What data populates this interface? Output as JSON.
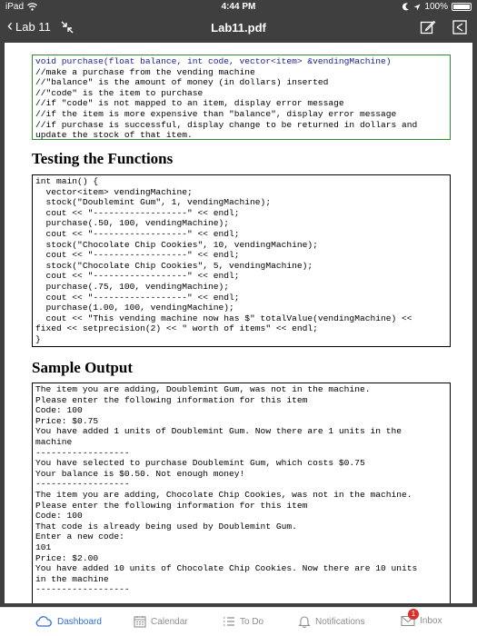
{
  "status_bar": {
    "device": "iPad",
    "time": "4:44 PM",
    "battery": "100%"
  },
  "nav": {
    "back_label": "Lab 11",
    "title": "Lab11.pdf"
  },
  "document": {
    "purchase_code": [
      "void purchase(float balance, int code, vector<item> &vendingMachine)",
      "//make a purchase from the vending machine",
      "//\"balance\" is the amount of money (in dollars) inserted",
      "//\"code\" is the item to purchase",
      "//if \"code\" is not mapped to an item, display error message",
      "//if the item is more expensive than \"balance\", display error message",
      "//if purchase is successful, display change to be returned in dollars and",
      "update the stock of that item."
    ],
    "testing_heading": "Testing the Functions",
    "test_code": [
      "int main() {",
      "  vector<item> vendingMachine;",
      "  stock(\"Doublemint Gum\", 1, vendingMachine);",
      "  cout << \"------------------\" << endl;",
      "  purchase(.50, 100, vendingMachine);",
      "  cout << \"------------------\" << endl;",
      "  stock(\"Chocolate Chip Cookies\", 10, vendingMachine);",
      "  cout << \"------------------\" << endl;",
      "  stock(\"Chocolate Chip Cookies\", 5, vendingMachine);",
      "  cout << \"------------------\" << endl;",
      "  purchase(.75, 100, vendingMachine);",
      "  cout << \"------------------\" << endl;",
      "  purchase(1.00, 100, vendingMachine);",
      "  cout << \"This vending machine now has $\" totalValue(vendingMachine) <<",
      "fixed << setprecision(2) << \" worth of items\" << endl;",
      "}"
    ],
    "sample_heading": "Sample Output",
    "sample_output": [
      "The item you are adding, Doublemint Gum, was not in the machine.",
      "Please enter the following information for this item",
      "Code: 100",
      "Price: $0.75",
      "You have added 1 units of Doublemint Gum. Now there are 1 units in the",
      "machine",
      "------------------",
      "You have selected to purchase Doublemint Gum, which costs $0.75",
      "Your balance is $0.50. Not enough money!",
      "------------------",
      "The item you are adding, Chocolate Chip Cookies, was not in the machine.",
      "Please enter the following information for this item",
      "Code: 100",
      "That code is already being used by Doublemint Gum.",
      "Enter a new code:",
      "101",
      "Price: $2.00",
      "You have added 10 units of Chocolate Chip Cookies. Now there are 10 units",
      "in the machine",
      "------------------"
    ]
  },
  "tabs": [
    {
      "label": "Dashboard",
      "icon": "cloud-icon",
      "active": true
    },
    {
      "label": "Calendar",
      "icon": "calendar-icon"
    },
    {
      "label": "To Do",
      "icon": "list-icon"
    },
    {
      "label": "Notifications",
      "icon": "bell-icon"
    },
    {
      "label": "Inbox",
      "icon": "mail-icon",
      "badge": "1"
    }
  ],
  "colors": {
    "accent": "#2e6fd0",
    "chrome": "#3f3f3f",
    "badge": "#d9302b"
  }
}
